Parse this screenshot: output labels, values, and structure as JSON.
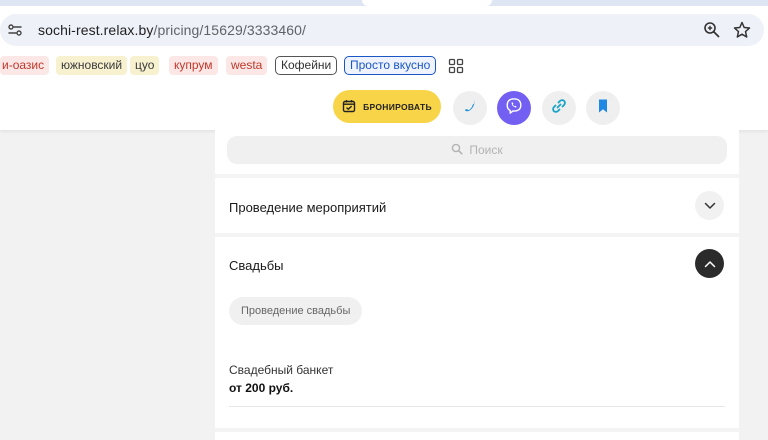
{
  "browser": {
    "url_host": "sochi-rest.relax.by",
    "url_path": "/pricing/15629/3333460/",
    "icons": [
      "site-info-icon",
      "zoom-icon",
      "star-icon"
    ]
  },
  "bookmarks": [
    {
      "label": "и-оазис",
      "style": "red"
    },
    {
      "label": "южновский",
      "style": "yellow"
    },
    {
      "label": "цуо",
      "style": "yellow"
    },
    {
      "label": "купрум",
      "style": "red"
    },
    {
      "label": "westa",
      "style": "red"
    },
    {
      "label": "Кофейни",
      "style": "outline-gray"
    },
    {
      "label": "Просто вкусно",
      "style": "outline-blue"
    }
  ],
  "header": {
    "book_label": "БРОНИРОВАТЬ",
    "actions": [
      "phone-icon",
      "viber-icon",
      "link-icon",
      "bookmark-icon"
    ]
  },
  "search": {
    "placeholder": "Поиск"
  },
  "sections": [
    {
      "title": "Проведение мероприятий",
      "expanded": false
    },
    {
      "title": "Свадьбы",
      "expanded": true
    }
  ],
  "wedding": {
    "chip": "Проведение свадьбы",
    "item_name": "Свадебный банкет",
    "item_price": "от 200 руб."
  },
  "colors": {
    "accent_yellow": "#f8d548",
    "viber": "#7360f2",
    "phone_blue": "#1a8fd8",
    "bookmark_blue": "#1e88e5"
  }
}
